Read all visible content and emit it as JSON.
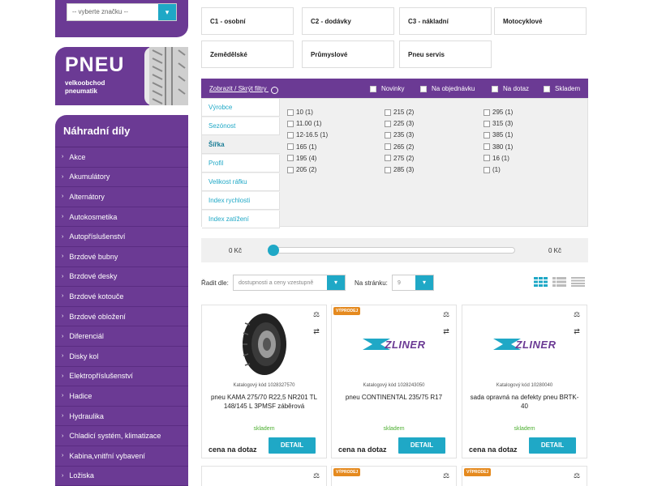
{
  "brand_select": {
    "placeholder": "-- vyberte značku --"
  },
  "promo": {
    "title": "PNEU",
    "subtitle_line1": "velkoobchod",
    "subtitle_line2": "pneumatik"
  },
  "parts": {
    "title": "Náhradní díly",
    "items": [
      "Akce",
      "Akumulátory",
      "Alternátory",
      "Autokosmetika",
      "Autopříslušenství",
      "Brzdové bubny",
      "Brzdové desky",
      "Brzdové kotouče",
      "Brzdové obložení",
      "Diferenciál",
      "Disky kol",
      "Elektropříslušenství",
      "Hadice",
      "Hydraulika",
      "Chladicí systém, klimatizace",
      "Kabina,vnitřní vybavení",
      "Ložiska"
    ]
  },
  "categories": [
    "C1 - osobní",
    "C2 - dodávky",
    "C3 - nákladní",
    "Motocyklové",
    "Zemědělské",
    "Průmyslové",
    "Pneu servis"
  ],
  "filter": {
    "toggle_label": "Zobrazit / Skrýt filtry",
    "flags": [
      "Novinky",
      "Na objednávku",
      "Na dotaz",
      "Skladem"
    ],
    "tabs": [
      "Výrobce",
      "Sezónost",
      "Šířka",
      "Profil",
      "Velikost ráfku",
      "Index rychlosti",
      "Index zatížení"
    ],
    "active_tab": "Šířka",
    "columns": [
      [
        "10 (1)",
        "11.00 (1)",
        "12-16.5 (1)",
        "165 (1)",
        "195 (4)",
        "205 (2)"
      ],
      [
        "215 (2)",
        "225 (3)",
        "235 (3)",
        "265 (2)",
        "275 (2)",
        "285 (3)"
      ],
      [
        "295 (1)",
        "315 (3)",
        "385 (1)",
        "380 (1)",
        "16 (1)",
        "(1)"
      ]
    ]
  },
  "price_filter": {
    "min_label": "0 Kč",
    "max_label": "0 Kč"
  },
  "sorting": {
    "sort_label": "Řadit dle:",
    "sort_value": "dostupnosti a ceny vzestupně",
    "per_page_label": "Na stránku:",
    "per_page_value": "9"
  },
  "products": [
    {
      "badge": "",
      "image": "tire",
      "code": "Katalogový kód 1028327570",
      "name": "pneu KAMA 275/70 R22,5 NR201 TL 148/145 L 3PMSF záběrová",
      "stock": "skladem",
      "price": "cena na dotaz",
      "button": "DETAIL"
    },
    {
      "badge": "VÝPRODEJ",
      "image": "zliner",
      "logo_text": "ZLINER",
      "code": "Katalogový kód 1028243050",
      "name": "pneu CONTINENTAL 235/75 R17",
      "stock": "skladem",
      "price": "cena na dotaz",
      "button": "DETAIL"
    },
    {
      "badge": "",
      "image": "zliner",
      "logo_text": "ZLINER",
      "code": "Katalogový kód 10280040",
      "name": "sada opravná na defekty pneu BRTK-40",
      "stock": "skladem",
      "price": "cena na dotaz",
      "button": "DETAIL"
    }
  ],
  "stub_products": [
    {
      "badge": ""
    },
    {
      "badge": "VÝPRODEJ"
    },
    {
      "badge": "VÝPRODEJ"
    }
  ],
  "colors": {
    "purple": "#6b3a94",
    "accent": "#1fa8c6",
    "badge": "#e58a1f",
    "stock": "#4caf30"
  }
}
